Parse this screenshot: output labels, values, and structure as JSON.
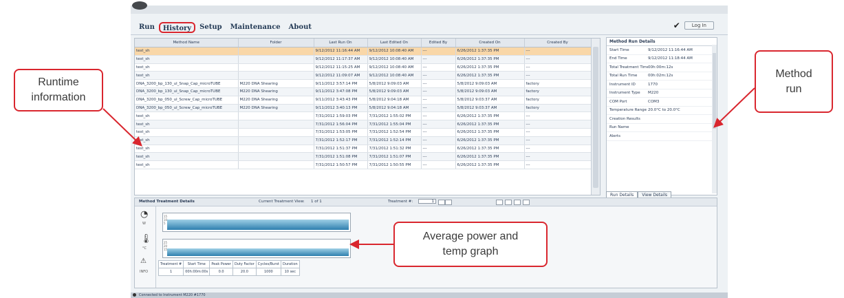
{
  "nav": {
    "tabs": [
      "Run",
      "History",
      "Setup",
      "Maintenance",
      "About"
    ],
    "active": "History",
    "login_label": "Log In"
  },
  "grid": {
    "columns": [
      "Method Name",
      "Folder",
      "Last Run On",
      "Last Edited On",
      "Edited By",
      "Created On",
      "Created By"
    ],
    "rows": [
      [
        "test_sh",
        "",
        "9/12/2012 11:16:44 AM",
        "9/12/2012 10:08:40 AM",
        "---",
        "6/26/2012 1:37:35 PM",
        "---"
      ],
      [
        "test_sh",
        "",
        "9/12/2012 11:17:37 AM",
        "9/12/2012 10:08:40 AM",
        "---",
        "6/26/2012 1:37:35 PM",
        "---"
      ],
      [
        "test_sh",
        "",
        "9/12/2012 11:15:25 AM",
        "9/12/2012 10:08:40 AM",
        "---",
        "6/26/2012 1:37:35 PM",
        "---"
      ],
      [
        "test_sh",
        "",
        "9/12/2012 11:09:07 AM",
        "9/12/2012 10:08:40 AM",
        "---",
        "6/26/2012 1:37:35 PM",
        "---"
      ],
      [
        "DNA_3200_bp_130_ul_Snap_Cap_microTUBE",
        "M220 DNA Shearing",
        "9/11/2012 3:57:14 PM",
        "5/8/2012 9:09:03 AM",
        "---",
        "5/8/2012 9:09:03 AM",
        "factory"
      ],
      [
        "DNA_3200_bp_130_ul_Snap_Cap_microTUBE",
        "M220 DNA Shearing",
        "9/11/2012 3:47:08 PM",
        "5/8/2012 9:09:03 AM",
        "---",
        "5/8/2012 9:09:03 AM",
        "factory"
      ],
      [
        "DNA_3200_bp_050_ul_Screw_Cap_microTUBE",
        "M220 DNA Shearing",
        "9/11/2012 3:43:43 PM",
        "5/8/2012 9:04:18 AM",
        "---",
        "5/8/2012 9:03:37 AM",
        "factory"
      ],
      [
        "DNA_3200_bp_050_ul_Screw_Cap_microTUBE",
        "M220 DNA Shearing",
        "9/11/2012 3:40:13 PM",
        "5/8/2012 9:04:18 AM",
        "---",
        "5/8/2012 9:03:37 AM",
        "factory"
      ],
      [
        "test_sh",
        "",
        "7/31/2012 1:59:03 PM",
        "7/31/2012 1:55:02 PM",
        "---",
        "6/26/2012 1:37:35 PM",
        "---"
      ],
      [
        "test_sh",
        "",
        "7/31/2012 1:56:04 PM",
        "7/31/2012 1:55:04 PM",
        "---",
        "6/26/2012 1:37:35 PM",
        "---"
      ],
      [
        "test_sh",
        "",
        "7/31/2012 1:53:05 PM",
        "7/31/2012 1:52:54 PM",
        "---",
        "6/26/2012 1:37:35 PM",
        "---"
      ],
      [
        "test_sh",
        "",
        "7/31/2012 1:52:17 PM",
        "7/31/2012 1:52:14 PM",
        "---",
        "6/26/2012 1:37:35 PM",
        "---"
      ],
      [
        "test_sh",
        "",
        "7/31/2012 1:51:37 PM",
        "7/31/2012 1:51:32 PM",
        "---",
        "6/26/2012 1:37:35 PM",
        "---"
      ],
      [
        "test_sh",
        "",
        "7/31/2012 1:51:08 PM",
        "7/31/2012 1:51:07 PM",
        "---",
        "6/26/2012 1:37:35 PM",
        "---"
      ],
      [
        "test_sh",
        "",
        "7/31/2012 1:50:57 PM",
        "7/31/2012 1:50:55 PM",
        "---",
        "6/26/2012 1:37:35 PM",
        "---"
      ]
    ]
  },
  "details": {
    "title": "Method Run Details",
    "rows": [
      [
        "Start Time",
        "9/12/2012 11:16:44 AM"
      ],
      [
        "End Time",
        "9/12/2012 11:18:44 AM"
      ],
      [
        "Total Treatment Time",
        "00h:00m:12s"
      ],
      [
        "Total Run Time",
        "00h:02m:12s"
      ],
      [
        "Instrument ID",
        "1770"
      ],
      [
        "Instrument Type",
        "M220"
      ],
      [
        "COM Port",
        "COM3"
      ],
      [
        "Temperature Range",
        "20.0°C to 20.0°C"
      ],
      [
        "Creation Results",
        ""
      ],
      [
        "Run Name",
        ""
      ],
      [
        "Alerts",
        ""
      ]
    ],
    "tabs": [
      "Run Details",
      "View Details"
    ]
  },
  "treatment": {
    "title": "Method Treatment Details",
    "view_label": "Current Treatment View:",
    "view_value": "1 of 1",
    "treatment_label": "Treatment #:",
    "treatment_value": "1",
    "power_unit": "W",
    "temp_unit": "°C",
    "info_label": "INFO",
    "power_ticks": [
      "15",
      "10",
      "5"
    ],
    "temp_ticks": [
      "25",
      "20",
      "15"
    ],
    "table_headers": [
      "Treatment #",
      "Start Time",
      "Peak Power",
      "Duty Factor",
      "Cycles/Burst",
      "Duration"
    ],
    "table_values": [
      "1",
      "00h:00m:00s",
      "0.0",
      "20.0",
      "1000",
      "10 sec"
    ]
  },
  "status": "Connected to Instrument M220 #1770",
  "callouts": {
    "runtime": "Runtime information",
    "method_run": "Method run",
    "avg_graph": "Average power and temp graph"
  }
}
